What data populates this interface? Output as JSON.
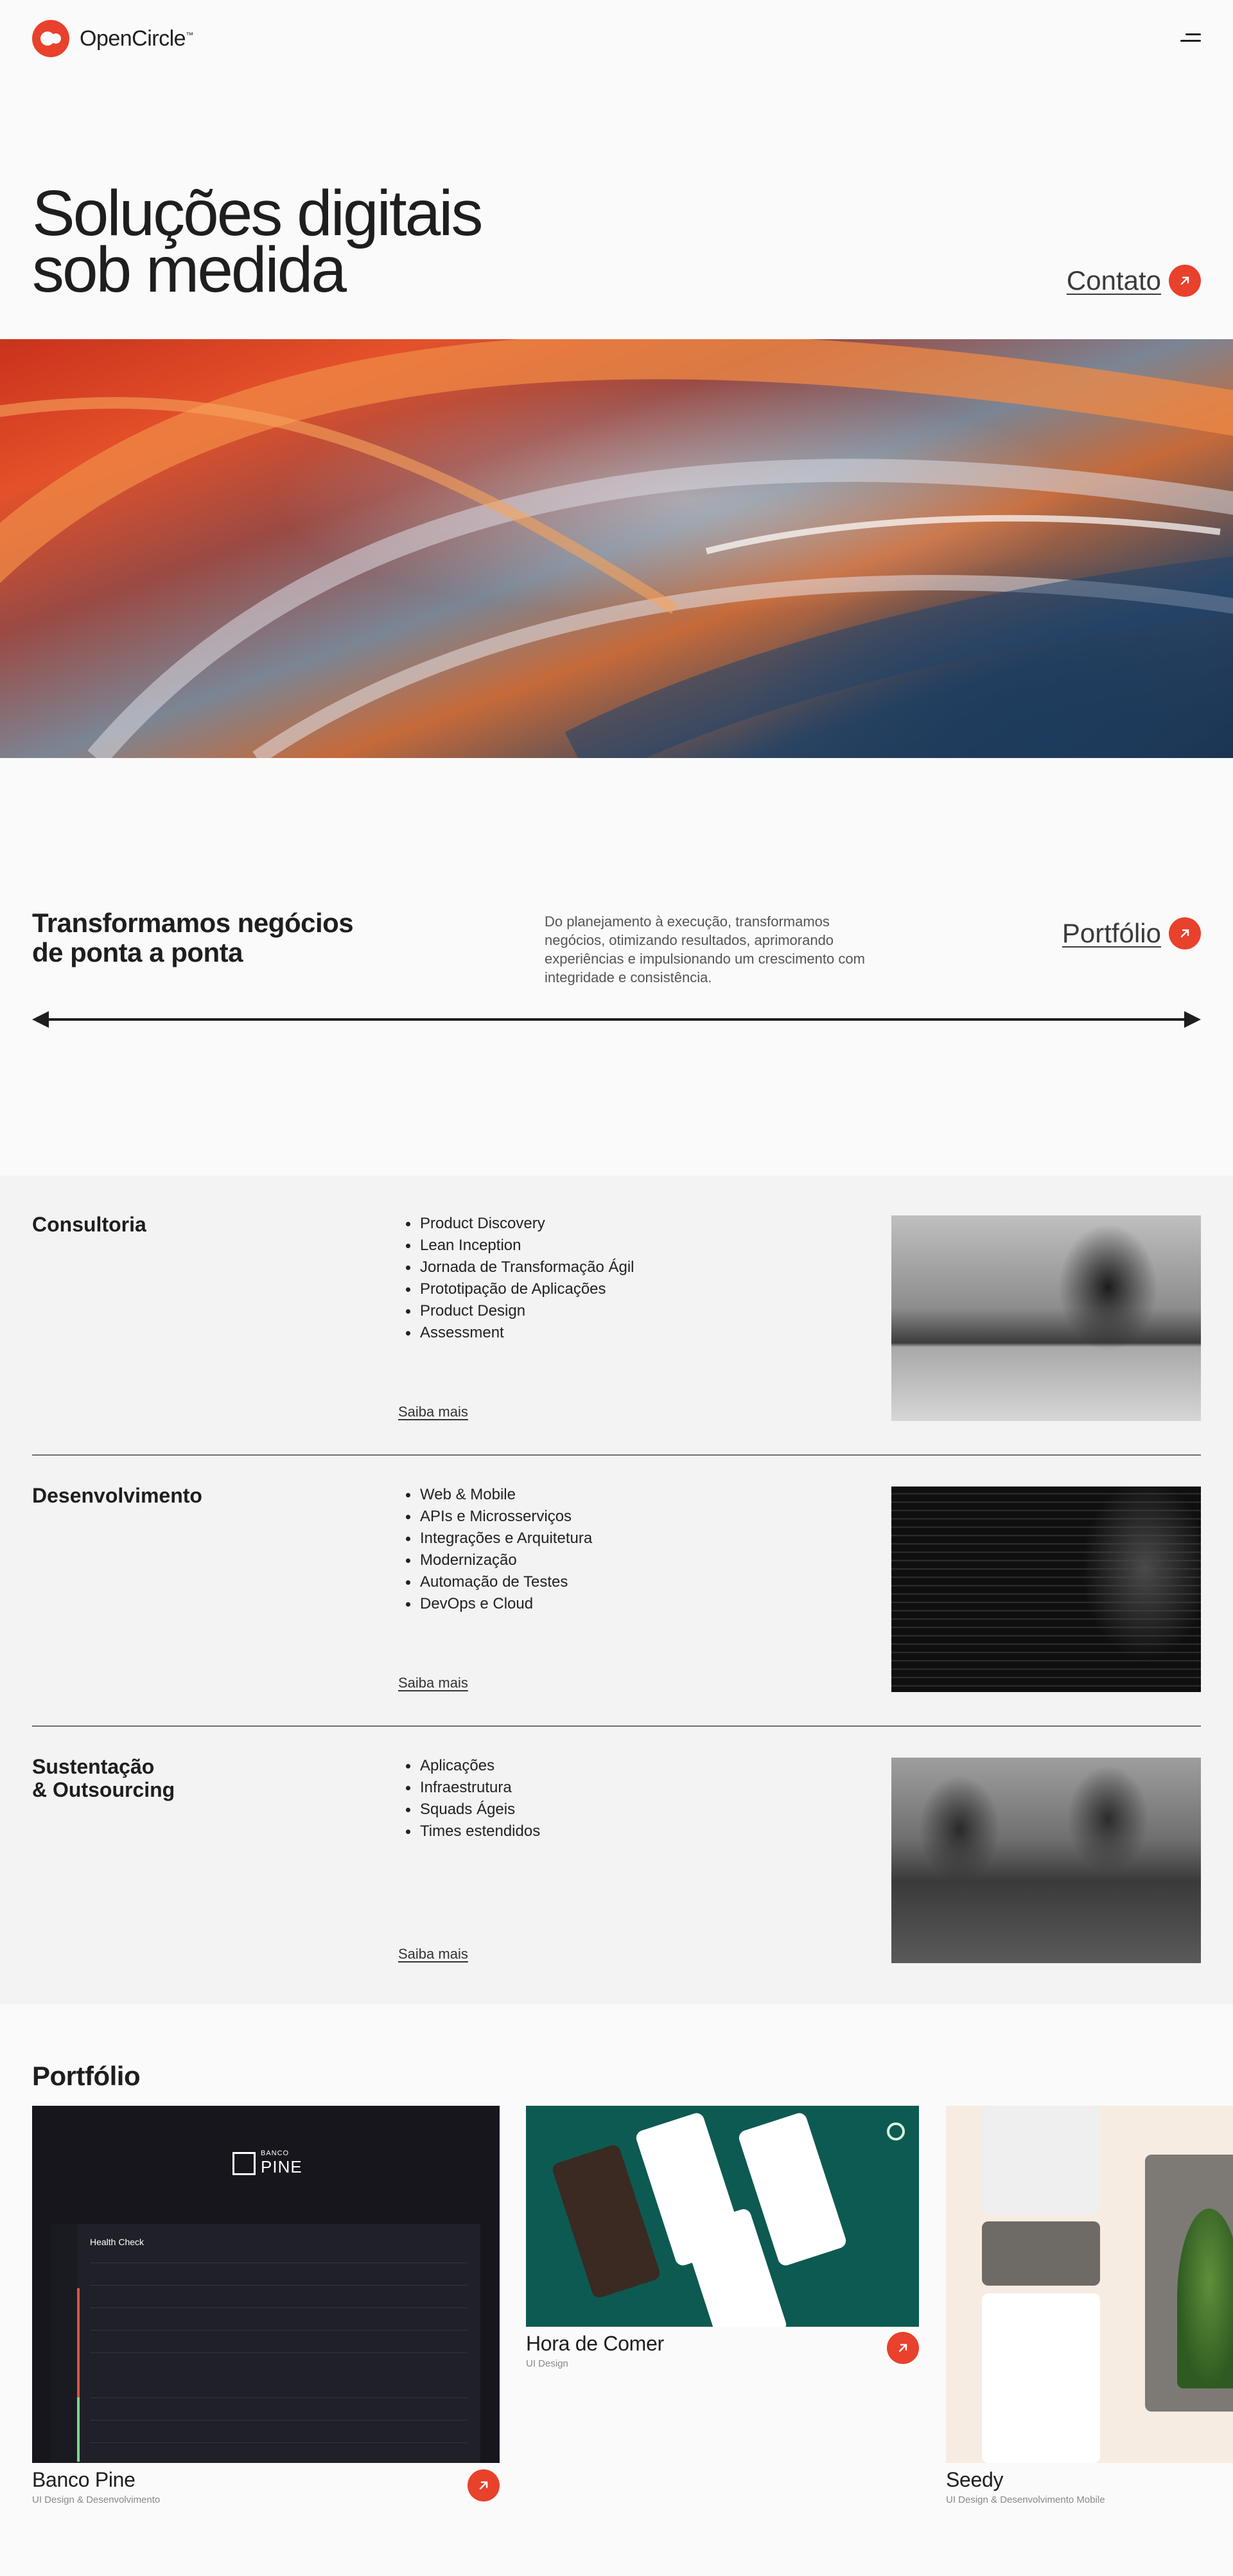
{
  "brand": {
    "name": "OpenCircle",
    "trademark": "™"
  },
  "hero": {
    "title_line1": "Soluções digitais",
    "title_line2": "sob medida",
    "cta_label": "Contato"
  },
  "intro": {
    "title_line1": "Transformamos negócios",
    "title_line2": "de ponta a ponta",
    "text": "Do planejamento à execução, transformamos negócios, otimizando resultados, aprimorando experiências e impulsionando um crescimento com integridade e consistência.",
    "cta_label": "Portfólio"
  },
  "services": [
    {
      "title": "Consultoria",
      "items": [
        "Product Discovery",
        "Lean Inception",
        "Jornada de Transformação Ágil",
        "Prototipação de Aplicações",
        "Product Design",
        "Assessment"
      ],
      "more_label": "Saiba mais"
    },
    {
      "title": "Desenvolvimento",
      "items": [
        "Web & Mobile",
        "APIs e Microsserviços",
        "Integrações e Arquitetura",
        "Modernização",
        "Automação de Testes",
        "DevOps e Cloud"
      ],
      "more_label": "Saiba mais"
    },
    {
      "title": "Sustentação\n& Outsourcing",
      "items": [
        "Aplicações",
        "Infraestrutura",
        "Squads Ágeis",
        "Times estendidos"
      ],
      "more_label": "Saiba mais"
    }
  ],
  "portfolio": {
    "title": "Portfólio",
    "cards": [
      {
        "title": "Banco Pine",
        "subtitle": "UI Design & Desenvolvimento",
        "thumb_brand_small": "BANCO",
        "thumb_brand_big": "PINE",
        "thumb_screen_title": "Health Check"
      },
      {
        "title": "Hora de Comer",
        "subtitle": "UI Design"
      },
      {
        "title": "Seedy",
        "subtitle": "UI Design & Desenvolvimento Mobile"
      }
    ]
  },
  "colors": {
    "accent": "#e8412c",
    "text": "#1e1e1e",
    "background": "#fafafa",
    "section_bg": "#f3f3f3"
  },
  "icons": {
    "menu": "menu-icon",
    "arrow": "arrow-up-right-icon"
  }
}
